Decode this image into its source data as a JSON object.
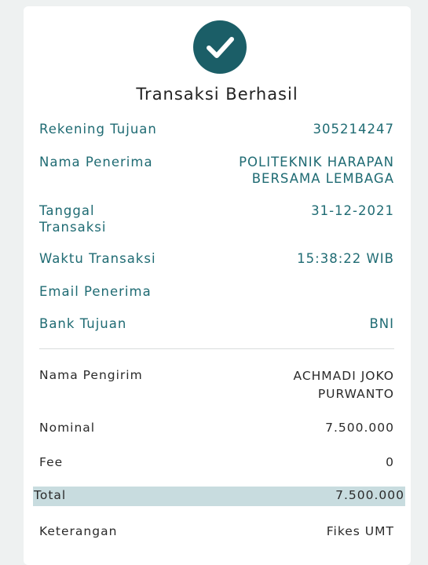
{
  "status_title": "Transaksi Berhasil",
  "icon": "check-icon",
  "colors": {
    "accent": "#1b5e67",
    "label_teal": "#1f6b73",
    "total_band": "#c8dcdf"
  },
  "recipient": {
    "rekening_label": "Rekening Tujuan",
    "rekening_value": "305214247",
    "nama_label": "Nama Penerima",
    "nama_value_line1": "POLITEKNIK HARAPAN",
    "nama_value_line2": "BERSAMA LEMBAGA",
    "tanggal_label_line1": "Tanggal",
    "tanggal_label_line2": "Transaksi",
    "tanggal_value": "31-12-2021",
    "waktu_label": "Waktu Transaksi",
    "waktu_value": "15:38:22 WIB",
    "email_label": "Email Penerima",
    "email_value": "",
    "bank_label": "Bank Tujuan",
    "bank_value": "BNI"
  },
  "sender": {
    "nama_label": "Nama Pengirim",
    "nama_value_line1": "ACHMADI JOKO",
    "nama_value_line2": "PURWANTO",
    "nominal_label": "Nominal",
    "nominal_value": "7.500.000",
    "fee_label": "Fee",
    "fee_value": "0",
    "total_label": "Total",
    "total_value": "7.500.000",
    "keterangan_label": "Keterangan",
    "keterangan_value": "Fikes UMT"
  }
}
